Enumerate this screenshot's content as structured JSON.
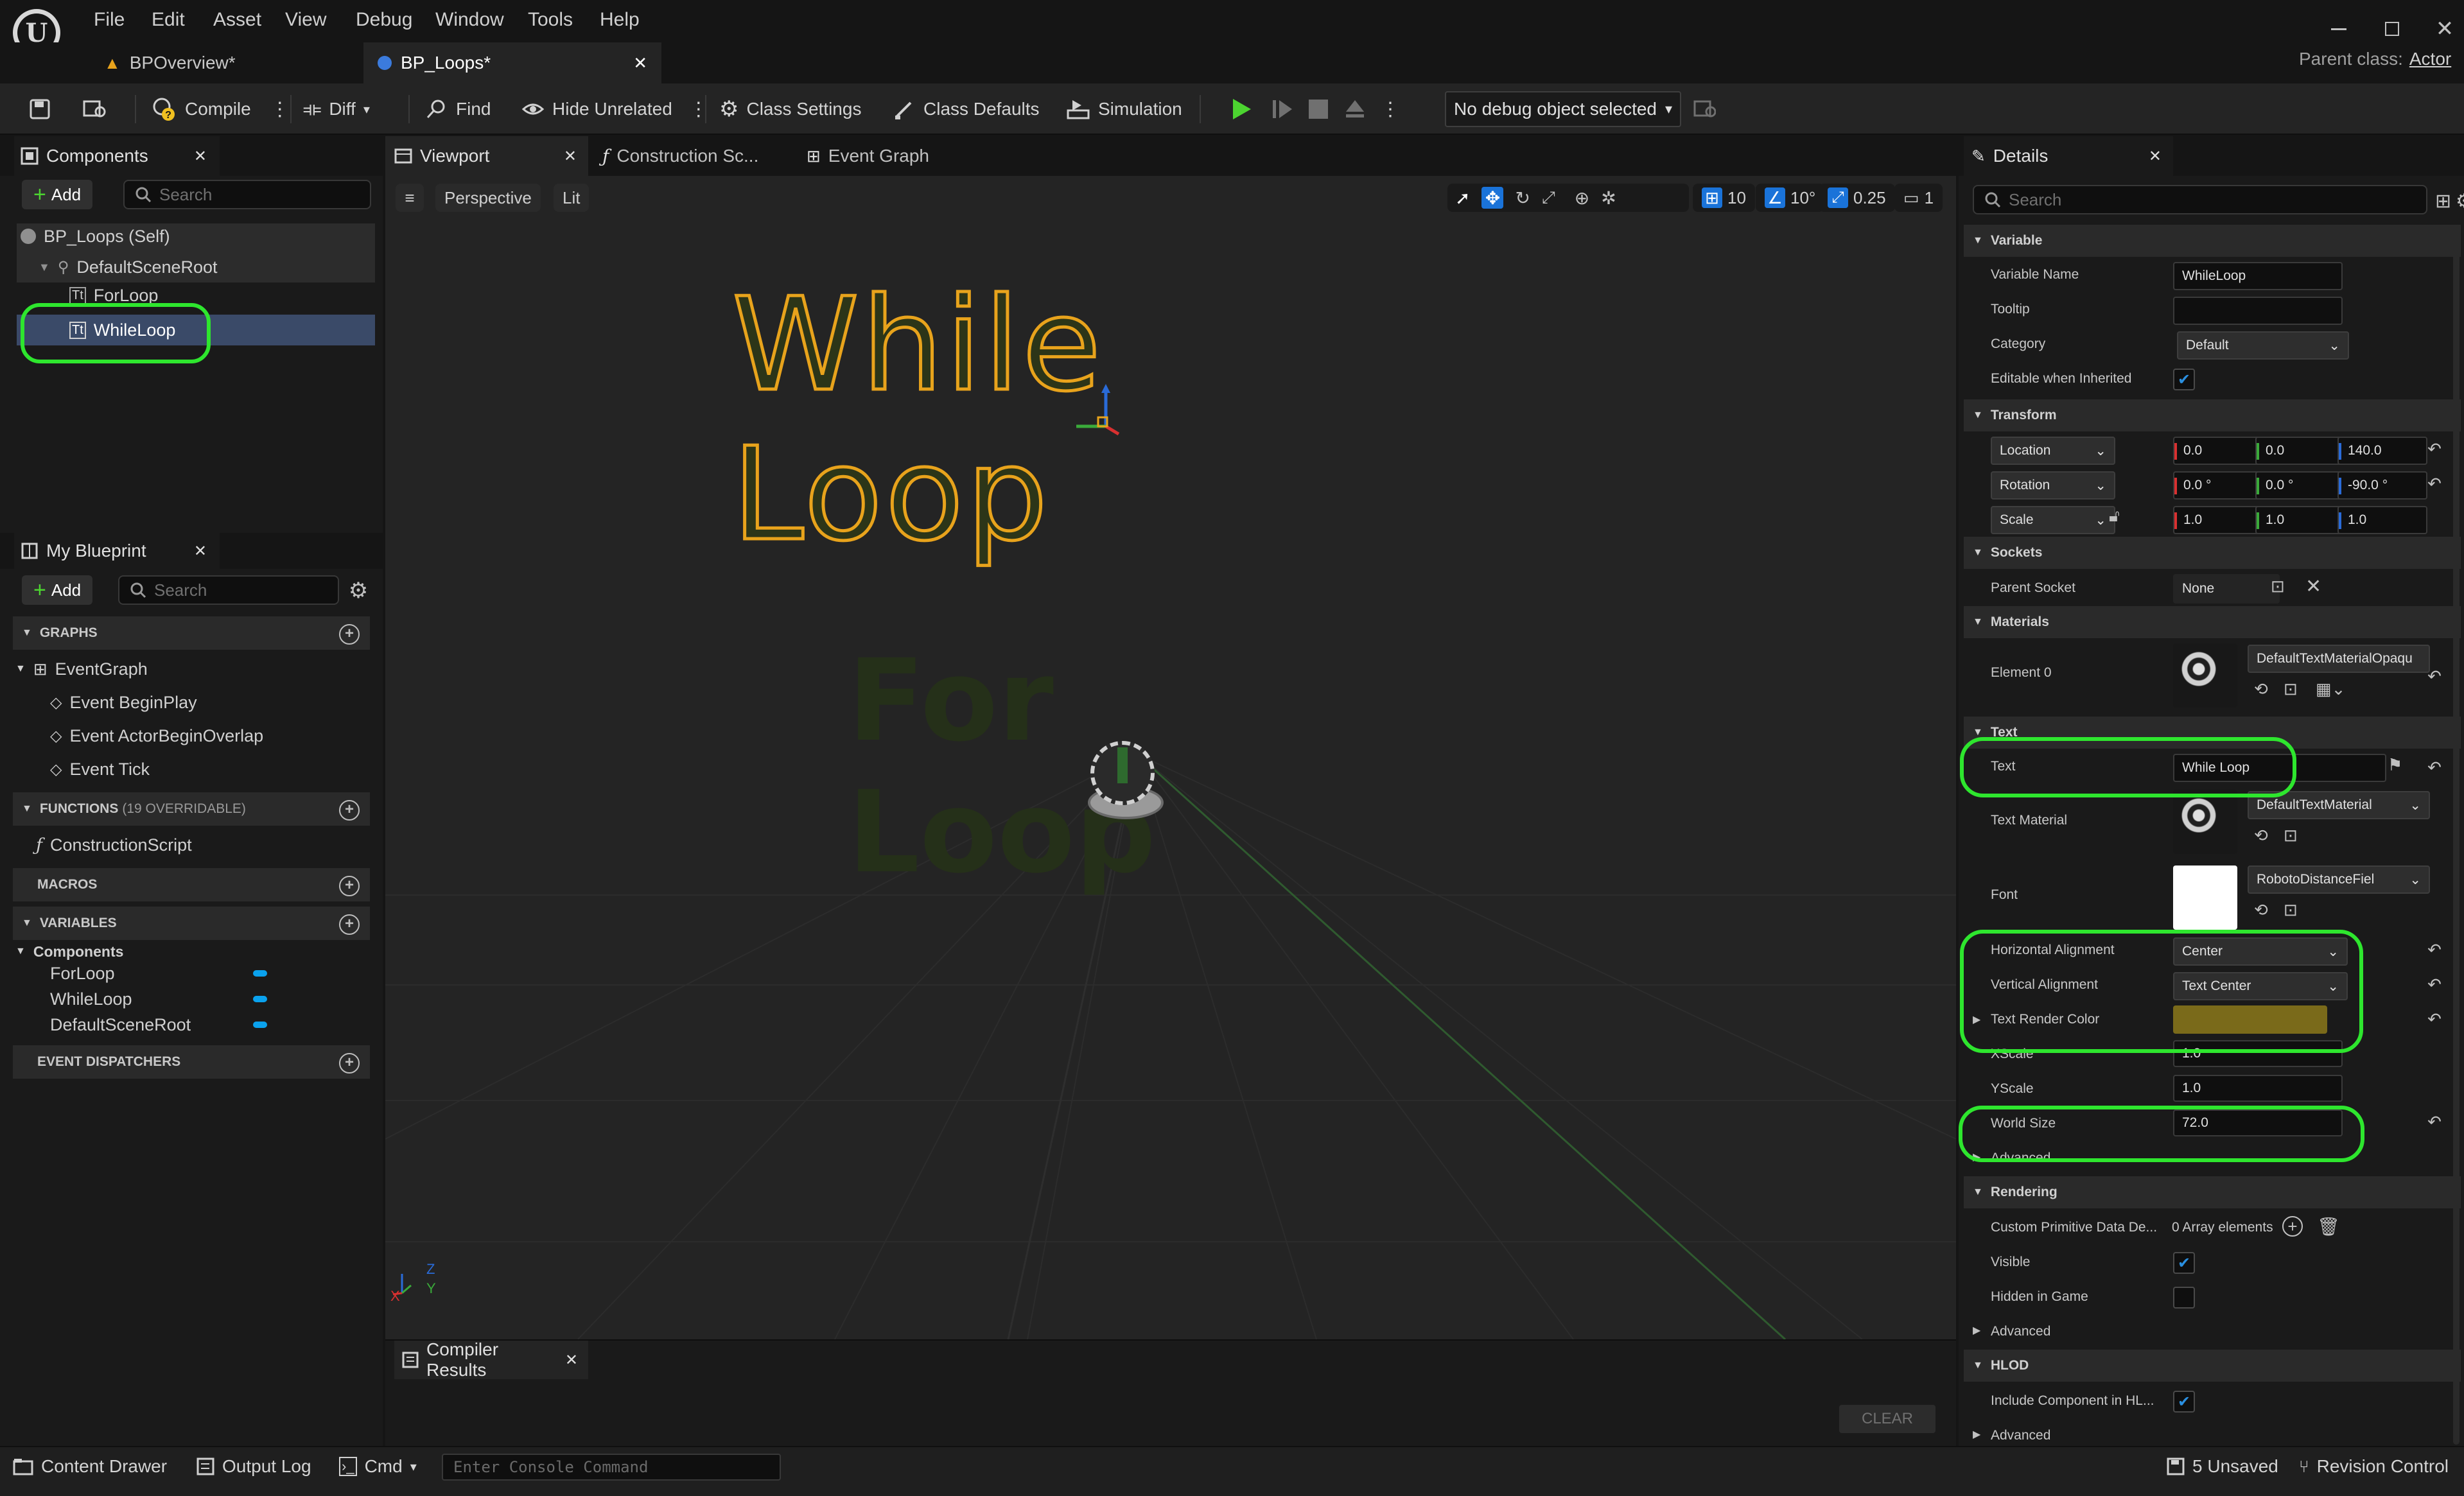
{
  "menu": [
    "File",
    "Edit",
    "Asset",
    "View",
    "Debug",
    "Window",
    "Tools",
    "Help"
  ],
  "doc_tabs": [
    {
      "label": "BPOverview*"
    },
    {
      "label": "BP_Loops*"
    }
  ],
  "parent_class": {
    "label": "Parent class:",
    "value": "Actor"
  },
  "toolbar": {
    "compile": "Compile",
    "diff": "Diff",
    "find": "Find",
    "hide_unrelated": "Hide Unrelated",
    "class_settings": "Class Settings",
    "class_defaults": "Class Defaults",
    "simulation": "Simulation",
    "debug_object": "No debug object selected"
  },
  "components": {
    "tab_label": "Components",
    "add_label": "Add",
    "search_placeholder": "Search",
    "items": [
      "BP_Loops (Self)",
      "DefaultSceneRoot",
      "ForLoop",
      "WhileLoop"
    ]
  },
  "my_blueprint": {
    "tab_label": "My Blueprint",
    "add_label": "Add",
    "search_placeholder": "Search",
    "graphs_header": "GRAPHS",
    "event_graph": "EventGraph",
    "events": [
      "Event BeginPlay",
      "Event ActorBeginOverlap",
      "Event Tick"
    ],
    "functions_header": "FUNCTIONS",
    "functions_count": "(19 OVERRIDABLE)",
    "construction_script": "ConstructionScript",
    "macros_header": "MACROS",
    "variables_header": "VARIABLES",
    "components_category": "Components",
    "variables": [
      "ForLoop",
      "WhileLoop",
      "DefaultSceneRoot"
    ],
    "event_dispatchers_header": "EVENT DISPATCHERS"
  },
  "editor_tabs": {
    "viewport": "Viewport",
    "construction": "Construction Sc...",
    "event_graph": "Event Graph"
  },
  "viewport": {
    "perspective": "Perspective",
    "lit": "Lit",
    "grid_snap": "10",
    "rot_snap": "10°",
    "scale_snap": "0.25",
    "camera_speed": "1",
    "text_while": "While Loop",
    "text_for": "For Loop",
    "axis_x": "X",
    "axis_y": "Y",
    "axis_z": "Z"
  },
  "compiler": {
    "tab_label": "Compiler Results",
    "clear_label": "CLEAR"
  },
  "details": {
    "tab_label": "Details",
    "search_placeholder": "Search",
    "variable": {
      "header": "Variable",
      "name_label": "Variable Name",
      "name_value": "WhileLoop",
      "tooltip_label": "Tooltip",
      "tooltip_value": "",
      "category_label": "Category",
      "category_value": "Default",
      "editable_label": "Editable when Inherited"
    },
    "transform": {
      "header": "Transform",
      "location_label": "Location",
      "location": [
        "0.0",
        "0.0",
        "140.0"
      ],
      "rotation_label": "Rotation",
      "rotation": [
        "0.0 °",
        "0.0 °",
        "-90.0 °"
      ],
      "scale_label": "Scale",
      "scale": [
        "1.0",
        "1.0",
        "1.0"
      ]
    },
    "sockets": {
      "header": "Sockets",
      "parent_socket_label": "Parent Socket",
      "parent_socket_value": "None"
    },
    "materials": {
      "header": "Materials",
      "element0_label": "Element 0",
      "element0_value": "DefaultTextMaterialOpaqu"
    },
    "text": {
      "header": "Text",
      "text_label": "Text",
      "text_value": "While Loop",
      "material_label": "Text Material",
      "material_value": "DefaultTextMaterial",
      "font_label": "Font",
      "font_value": "RobotoDistanceFiel",
      "h_align_label": "Horizontal Alignment",
      "h_align_value": "Center",
      "v_align_label": "Vertical Alignment",
      "v_align_value": "Text Center",
      "color_label": "Text Render Color",
      "render_color": "#7a6a1a",
      "xscale_label": "XScale",
      "xscale_value": "1.0",
      "yscale_label": "YScale",
      "yscale_value": "1.0",
      "world_size_label": "World Size",
      "world_size_value": "72.0",
      "advanced_label": "Advanced"
    },
    "rendering": {
      "header": "Rendering",
      "custom_label": "Custom Primitive Data De...",
      "custom_value": "0 Array elements",
      "visible_label": "Visible",
      "hidden_label": "Hidden in Game",
      "advanced_label": "Advanced"
    },
    "hlod": {
      "header": "HLOD",
      "include_label": "Include Component in HL...",
      "advanced_label": "Advanced"
    }
  },
  "statusbar": {
    "content_drawer": "Content Drawer",
    "output_log": "Output Log",
    "cmd": "Cmd",
    "console_placeholder": "Enter Console Command",
    "unsaved": "5 Unsaved",
    "revision": "Revision Control"
  },
  "colors": {
    "highlight": "#2ee62e",
    "selection": "#3a4a68",
    "play_green": "#4cd430",
    "variable_blue": "#0aa2ee",
    "text_outline": "#e8a31c"
  }
}
